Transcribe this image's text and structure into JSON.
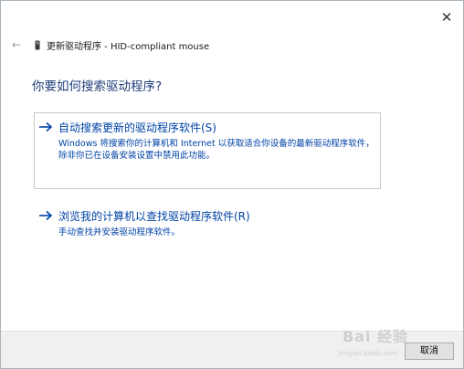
{
  "window": {
    "close_glyph": "✕",
    "back_glyph": "←",
    "title": "更新驱动程序 - HID-compliant mouse"
  },
  "heading": "你要如何搜索驱动程序?",
  "options": [
    {
      "title": "自动搜索更新的驱动程序软件(S)",
      "description": "Windows 将搜索你的计算机和 Internet 以获取适合你设备的最新驱动程序软件，除非你已在设备安装设置中禁用此功能。"
    },
    {
      "title": "浏览我的计算机以查找驱动程序软件(R)",
      "description": "手动查找并安装驱动程序软件。"
    }
  ],
  "footer": {
    "cancel_label": "取消"
  },
  "watermark": {
    "text": "Bai 经验",
    "sub": "jingyan.baidu.com"
  },
  "colors": {
    "link": "#0043a6",
    "heading": "#1e3d7a",
    "footer_bg": "#f0f0f0"
  },
  "icons": {
    "close": "close-icon",
    "back": "back-arrow-icon",
    "device": "mouse-device-icon",
    "option_arrow": "arrow-right-icon"
  }
}
